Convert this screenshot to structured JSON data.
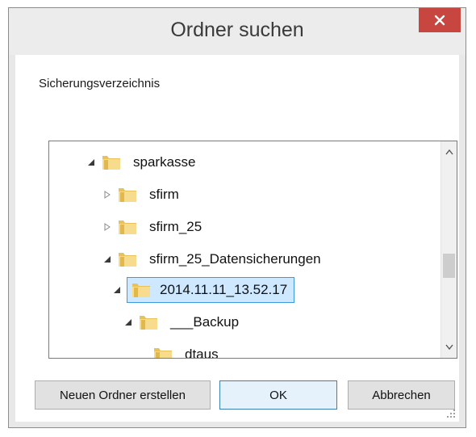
{
  "window": {
    "title": "Ordner suchen",
    "close_glyph": "✕"
  },
  "prompt": "Sicherungsverzeichnis",
  "tree": {
    "nodes": [
      {
        "label": "sparkasse",
        "expanded": true,
        "level": 0
      },
      {
        "label": "sfirm",
        "expanded": false,
        "level": 1
      },
      {
        "label": "sfirm_25",
        "expanded": false,
        "level": 1
      },
      {
        "label": "sfirm_25_Datensicherungen",
        "expanded": true,
        "level": 1
      },
      {
        "label": "2014.11.11_13.52.17",
        "expanded": true,
        "level": 2,
        "selected": true
      },
      {
        "label": "___Backup",
        "expanded": true,
        "level": 3
      },
      {
        "label": "dtaus",
        "expanded": false,
        "level": 4
      }
    ]
  },
  "buttons": {
    "new_folder": "Neuen Ordner erstellen",
    "ok": "OK",
    "cancel": "Abbrechen"
  },
  "colors": {
    "close_button": "#c7463f",
    "selection_fill": "#cde8ff",
    "selection_border": "#3b99e0",
    "folder_yellow": "#f4d27a"
  },
  "icons": {
    "expander_expanded": "triangle-down-right",
    "expander_collapsed": "triangle-right-outline",
    "folder": "folder-icon"
  }
}
